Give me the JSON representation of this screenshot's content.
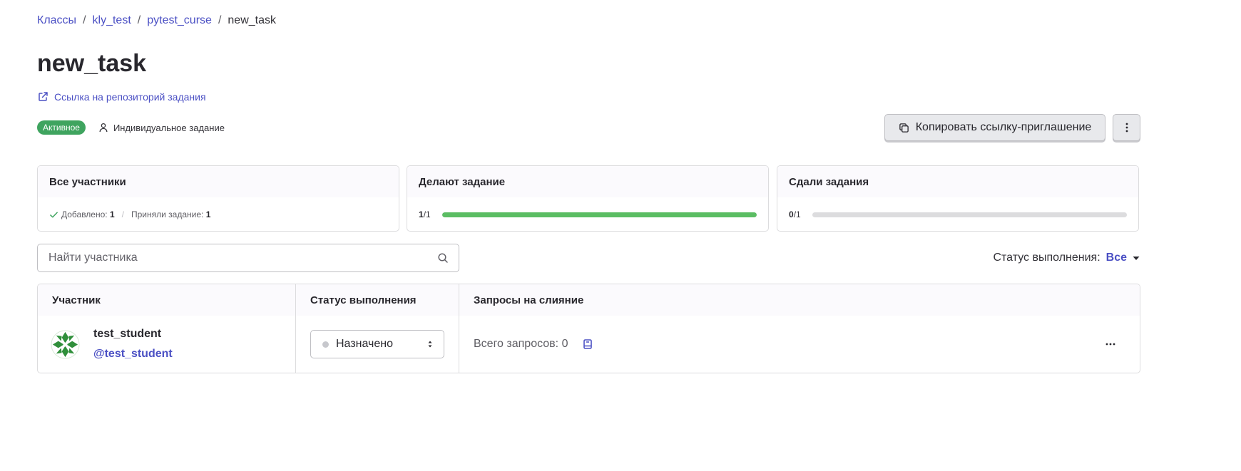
{
  "breadcrumb": {
    "items": [
      "Классы",
      "kly_test",
      "pytest_curse"
    ],
    "current": "new_task",
    "separator": "/"
  },
  "page": {
    "title": "new_task",
    "repo_link": "Ссылка на репозиторий задания",
    "status_badge": "Активное",
    "task_type": "Индивидуальное задание"
  },
  "actions": {
    "copy_invite": "Копировать ссылку-приглашение",
    "more_icon": "vertical-ellipsis-icon"
  },
  "stats": {
    "all_participants": {
      "title": "Все участники",
      "added_label": "Добавлено:",
      "added_value": "1",
      "accepted_label": "Приняли задание:",
      "accepted_value": "1"
    },
    "doing": {
      "title": "Делают задание",
      "done": "1",
      "total": "/1",
      "progress": 1.0
    },
    "submitted": {
      "title": "Сдали задания",
      "done": "0",
      "total": "/1",
      "progress": 0.0
    }
  },
  "search": {
    "placeholder": "Найти участника",
    "value": ""
  },
  "filter": {
    "label": "Статус выполнения:",
    "value": "Все"
  },
  "table": {
    "headers": [
      "Участник",
      "Статус выполнения",
      "Запросы на слияние"
    ],
    "rows": [
      {
        "name": "test_student",
        "handle": "@test_student",
        "status": "Назначено",
        "merge_requests": "Всего запросов: 0"
      }
    ]
  },
  "colors": {
    "accent": "#4b50c4",
    "active_badge": "#3fa45f",
    "progress_fill": "#5bbd63",
    "progress_track": "#dcdcde",
    "avatar": "#2f8f3a"
  }
}
